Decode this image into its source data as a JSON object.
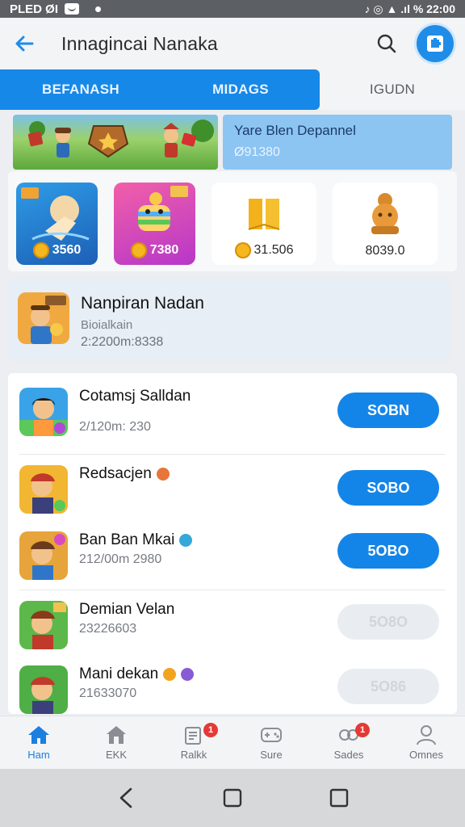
{
  "status_bar": {
    "left_text": "PLED ØI",
    "right_text": "♪ ◎ ▲ .ıl % 22:00"
  },
  "app_bar": {
    "title": "Innagincai Nanaka"
  },
  "tabs": [
    {
      "label": "BEFANASH",
      "active": true
    },
    {
      "label": "MIDAGS",
      "active": true
    },
    {
      "label": "IGUDN",
      "active": false
    }
  ],
  "banner": {
    "title": "Yare Blen Depannel",
    "subtitle": "Ø91380"
  },
  "featured": [
    {
      "price": "3560"
    },
    {
      "price": "7380"
    },
    {
      "price": "31.506"
    },
    {
      "price": "8039.0"
    }
  ],
  "highlight": {
    "title": "Nanpiran Nadan",
    "subtitle": "Bioialkain",
    "meta": "2:2200m:8338"
  },
  "list": [
    {
      "title": "Cotamsj Salldan",
      "meta": "2/120m: 230",
      "button": "SOBN",
      "enabled": true
    },
    {
      "title": "Redsacjen",
      "meta": "",
      "button": "SOBO",
      "enabled": true
    },
    {
      "title": "Ban Ban Mkai",
      "meta": "212/00m 2980",
      "button": "5OBO",
      "enabled": true
    },
    {
      "title": "Demian Velan",
      "meta": "23226603",
      "button": "5O8O",
      "enabled": false
    },
    {
      "title": "Mani dekan",
      "meta": "21633070",
      "button": "5O86",
      "enabled": false
    }
  ],
  "bottom_nav": [
    {
      "label": "Ham",
      "badge": ""
    },
    {
      "label": "EKK",
      "badge": ""
    },
    {
      "label": "Ralkk",
      "badge": "1"
    },
    {
      "label": "Sure",
      "badge": ""
    },
    {
      "label": "Sades",
      "badge": "1"
    },
    {
      "label": "Omnes",
      "badge": ""
    }
  ],
  "colors": {
    "accent": "#1688e8",
    "badge": "#e53935"
  }
}
